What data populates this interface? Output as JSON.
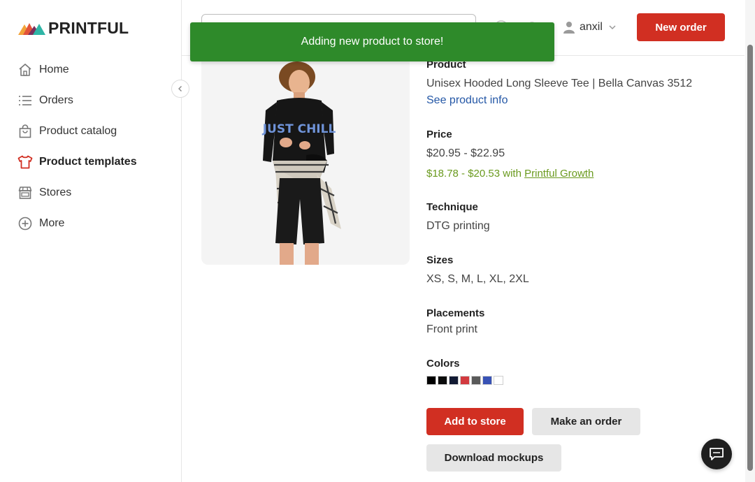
{
  "brand": {
    "name": "PRINTFUL"
  },
  "sidebar": {
    "items": [
      {
        "label": "Home",
        "icon": "home-icon"
      },
      {
        "label": "Orders",
        "icon": "list-icon"
      },
      {
        "label": "Product catalog",
        "icon": "shopping-bag-icon"
      },
      {
        "label": "Product templates",
        "icon": "tshirt-icon",
        "active": true
      },
      {
        "label": "Stores",
        "icon": "store-icon"
      },
      {
        "label": "More",
        "icon": "plus-circle-icon"
      }
    ]
  },
  "header": {
    "search": {
      "placeholder": "",
      "value": ""
    },
    "user": {
      "name": "anxil"
    },
    "new_order_label": "New order"
  },
  "toast": {
    "message": "Adding new product to store!"
  },
  "product": {
    "product_heading": "Product",
    "name": "Unisex Hooded Long Sleeve Tee | Bella Canvas 3512",
    "see_info_label": "See product info",
    "price_heading": "Price",
    "price_range": "$20.95 - $22.95",
    "growth_price_prefix": "$18.78 - $20.53 with ",
    "growth_link_label": "Printful Growth",
    "technique_heading": "Technique",
    "technique": "DTG printing",
    "sizes_heading": "Sizes",
    "sizes": "XS, S, M, L, XL, 2XL",
    "placements_heading": "Placements",
    "placements": "Front print",
    "colors_heading": "Colors",
    "colors": [
      "#000000",
      "#0b0b0b",
      "#121a33",
      "#d23a3f",
      "#5a5a5a",
      "#3852b5",
      "#ffffff"
    ],
    "shirt_print_text": "JUST CHILL"
  },
  "actions": {
    "add_to_store_label": "Add to store",
    "make_order_label": "Make an order",
    "download_mockups_label": "Download mockups"
  },
  "theme": {
    "accent_red": "#d12f22",
    "toast_green": "#2e8a2a",
    "link_blue": "#2457a6",
    "growth_green": "#6a9a1e"
  }
}
